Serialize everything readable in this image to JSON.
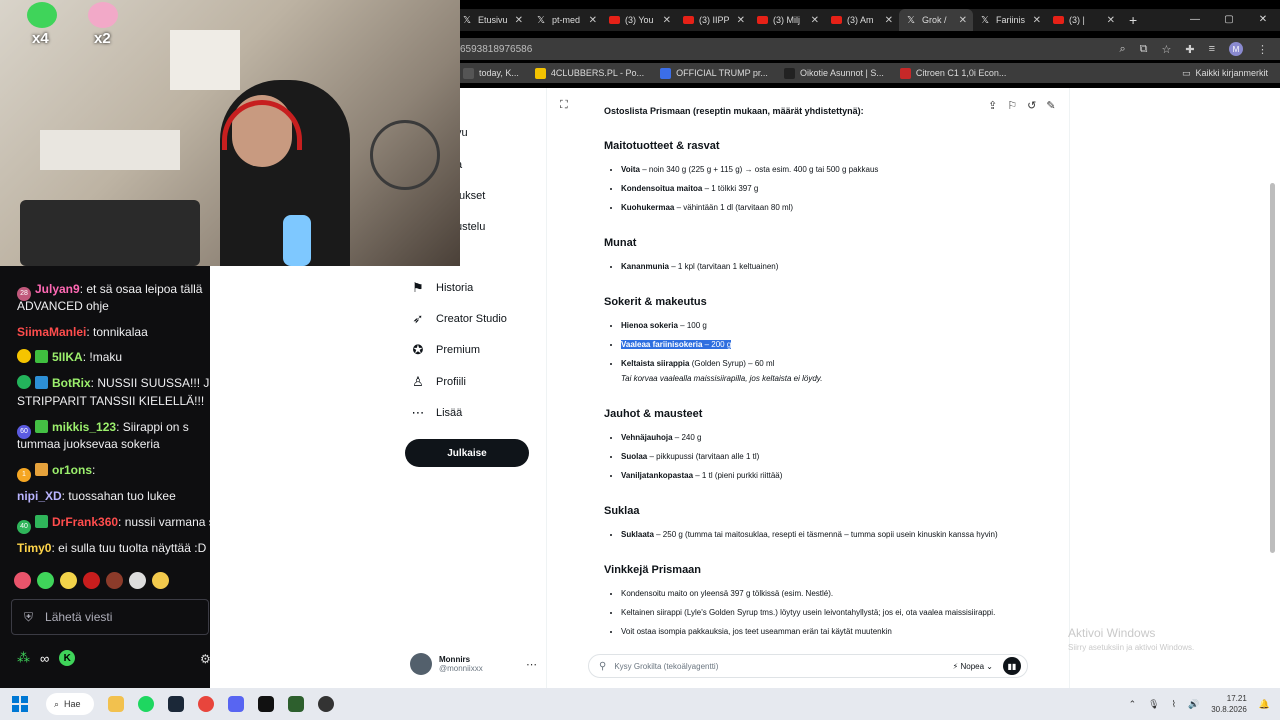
{
  "tabs": [
    {
      "label": "Etusivu",
      "icon": "x"
    },
    {
      "label": "pt-med",
      "icon": "x"
    },
    {
      "label": "(3) You",
      "icon": "yt"
    },
    {
      "label": "(3) IIPP",
      "icon": "yt"
    },
    {
      "label": "(3) Milj",
      "icon": "yt"
    },
    {
      "label": "(3) Am",
      "icon": "yt"
    },
    {
      "label": "Grok / ",
      "icon": "x",
      "active": true
    },
    {
      "label": "Fariinis",
      "icon": "x"
    },
    {
      "label": "(3) |",
      "icon": "yt"
    }
  ],
  "address": {
    "url": "6593818976586"
  },
  "bookmarks": [
    {
      "label": "today, K...",
      "color": "#555"
    },
    {
      "label": "4CLUBBERS.PL - Po...",
      "color": "#f2c200"
    },
    {
      "label": "OFFICIAL TRUMP pr...",
      "color": "#3b6ee8"
    },
    {
      "label": "Oikotie Asunnot | S...",
      "color": "#222"
    },
    {
      "label": "Citroen C1 1,0i Econ...",
      "color": "#c62828"
    }
  ],
  "bookmarks_right": "Kaikki kirjanmerkit",
  "nav": {
    "partial": [
      "vu",
      "a",
      "tukset",
      "ustelu"
    ],
    "items": [
      {
        "label": "Historia",
        "icon": "bookmark-icon",
        "glyph": "⚑"
      },
      {
        "label": "Creator Studio",
        "icon": "rocket-icon",
        "glyph": "➶"
      },
      {
        "label": "Premium",
        "icon": "verified-icon",
        "glyph": "✪"
      },
      {
        "label": "Profiili",
        "icon": "person-icon",
        "glyph": "♙"
      },
      {
        "label": "Lisää",
        "icon": "more-icon",
        "glyph": "⋯"
      }
    ],
    "post": "Julkaise",
    "profile": {
      "name": "Monnirs",
      "handle": "@monniixxx"
    }
  },
  "content": {
    "intro": "Ostoslista Prismaan (reseptin mukaan, määrät yhdistettynä):",
    "sections": [
      {
        "title": "Maitotuotteet & rasvat",
        "items": [
          {
            "b": "Voita",
            "t": " – noin 340 g (225 g + 115 g) → osta esim. 400 g tai 500 g pakkaus"
          },
          {
            "b": "Kondensoitua maitoa",
            "t": " – 1 tölkki 397 g"
          },
          {
            "b": "Kuohukermaa",
            "t": " – vähintään 1 dl (tarvitaan 80 ml)"
          }
        ]
      },
      {
        "title": "Munat",
        "items": [
          {
            "b": "Kananmunia",
            "t": " – 1 kpl (tarvitaan 1 keltuainen)"
          }
        ]
      },
      {
        "title": "Sokerit & makeutus",
        "items": [
          {
            "b": "Hienoa sokeria",
            "t": " – 100 g"
          },
          {
            "b": "Vaaleaa fariinisokeria",
            "t": " – 200 g",
            "sel": true
          },
          {
            "b": "Keltaista siirappia",
            "t": " (Golden Syrup) – 60 ml",
            "note": "Tai korvaa vaalealla maissisiirapilla, jos keltaista ei löydy."
          }
        ]
      },
      {
        "title": "Jauhot & mausteet",
        "items": [
          {
            "b": "Vehnäjauhoja",
            "t": " – 240 g"
          },
          {
            "b": "Suolaa",
            "t": " – pikkupussi (tarvitaan alle 1 tl)"
          },
          {
            "b": "Vaniljatankopastaa",
            "t": " – 1 tl (pieni purkki riittää)"
          }
        ]
      },
      {
        "title": "Suklaa",
        "items": [
          {
            "b": "Suklaata",
            "t": " – 250 g (tumma tai maitosuklaa, resepti ei täsmennä – tumma sopii usein kinuskin kanssa hyvin)"
          }
        ]
      },
      {
        "title": "Vinkkejä Prismaan",
        "items": [
          {
            "b": "",
            "t": "Kondensoitu maito on yleensä 397 g tölkissä (esim. Nestlé)."
          },
          {
            "b": "",
            "t": "Keltainen siirappi (Lyle's Golden Syrup tms.) löytyy usein leivontahyllystä; jos ei, ota vaalea maissisiirappi."
          },
          {
            "b": "",
            "t": "Voit ostaa isompia pakkauksia, jos teet useamman erän tai käytät muutenkin"
          }
        ]
      }
    ]
  },
  "chatbox": {
    "placeholder": "Kysy Grokilta (tekoälyagentti)",
    "mode": "Nopea"
  },
  "activate": {
    "title": "Aktivoi Windows",
    "sub": "Siirry asetuksiin ja aktivoi Windows."
  },
  "chat": {
    "messages": [
      {
        "user": "Julyan9",
        "color": "#ff69b4",
        "text": "et sä osaa leipoa tällä",
        "badge": "#c0587b",
        "badge_text": "28"
      },
      {
        "user": "",
        "color": "#fff",
        "text": "ADVANCED ohje"
      },
      {
        "user": "SiimaManlei",
        "color": "#ff4d4d",
        "text": "tonnikalaa"
      },
      {
        "user": "5IIKA",
        "color": "#9cf06d",
        "text": "!maku",
        "badge": "#f5c400",
        "sq": "#3fbf3f"
      },
      {
        "user": "BotRix",
        "color": "#9cf06d",
        "text": "NUSSII SUUSSA!!! J",
        "sq": "#2d8fd6",
        "badge": "#23b35b"
      },
      {
        "user": "",
        "color": "#fff",
        "text": "STRIPPARIT TANSSII KIELELLÄ!!!"
      },
      {
        "user": "mikkis_123",
        "color": "#9cf06d",
        "text": "Siirappi on s",
        "badge": "#5b5be0",
        "badge_text": "60",
        "sq": "#44c044"
      },
      {
        "user": "",
        "color": "#fff",
        "text": "tummaa juoksevaa sokeria"
      },
      {
        "user": "or1ons",
        "color": "#9cf06d",
        "text": "",
        "badge": "#f5a623",
        "badge_text": "1",
        "sq": "#e6a23c"
      },
      {
        "user": "nipi_XD",
        "color": "#b9b4ff",
        "text": "tuossahan tuo lukee"
      },
      {
        "user": "DrFrank360",
        "color": "#ff4d4d",
        "text": "nussii varmana sis",
        "sq": "#2fb55a",
        "badge_text": "40"
      },
      {
        "user": "Timy0",
        "color": "#ffd54a",
        "text": "ei sulla tuu tuolta näyttää :D"
      }
    ],
    "input_placeholder": "Lähetä viesti"
  },
  "cam": {
    "label1": "x4",
    "label2": "x2"
  },
  "taskbar": {
    "search": "Hae",
    "time": "17.21",
    "date": "30.8.2026"
  }
}
